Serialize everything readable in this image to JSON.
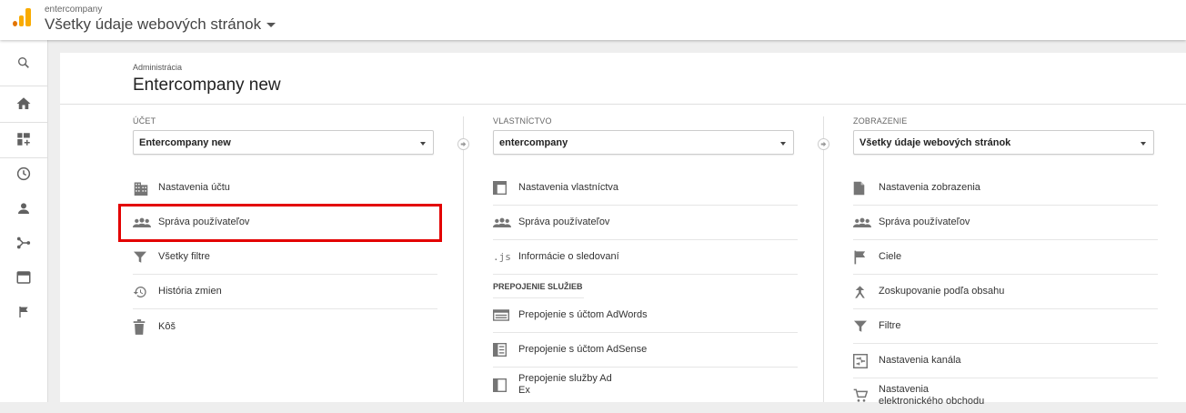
{
  "topbar": {
    "account_name": "entercompany",
    "view_name": "Všetky údaje webových stránok"
  },
  "colors": {
    "logo_orange": "#f9ab00",
    "logo_dark_orange": "#e37400",
    "highlight": "#e30000",
    "icon_gray": "#616161"
  },
  "rail": {
    "items": [
      {
        "icon": "search-icon"
      },
      {
        "icon": "home-icon"
      },
      {
        "icon": "customization-icon"
      },
      {
        "icon": "realtime-clock-icon"
      },
      {
        "icon": "audience-person-icon"
      },
      {
        "icon": "acquisition-icon"
      },
      {
        "icon": "behavior-icon"
      },
      {
        "icon": "conversions-flag-icon"
      }
    ]
  },
  "header": {
    "breadcrumb": "Administrácia",
    "title": "Entercompany new"
  },
  "account_col": {
    "label": "ÚČET",
    "selected": "Entercompany new",
    "items": [
      {
        "label": "Nastavenia účtu",
        "icon": "building-icon"
      },
      {
        "label": "Správa používateľov",
        "icon": "users-icon"
      },
      {
        "label": "Všetky filtre",
        "icon": "filter-icon"
      },
      {
        "label": "História zmien",
        "icon": "history-icon"
      },
      {
        "label": "Kôš",
        "icon": "trash-icon"
      }
    ]
  },
  "property_col": {
    "label": "VLASTNÍCTVO",
    "selected": "entercompany",
    "items": [
      {
        "label": "Nastavenia vlastníctva",
        "icon": "property-settings-icon"
      },
      {
        "label": "Správa používateľov",
        "icon": "users-icon"
      },
      {
        "label": "Informácie o sledovaní",
        "icon": "js-icon",
        "glyph": ".js"
      }
    ],
    "section_title": "PREPOJENIE SLUŽIEB",
    "section_items": [
      {
        "label": "Prepojenie s účtom AdWords",
        "icon": "adwords-icon"
      },
      {
        "label": "Prepojenie s účtom AdSense",
        "icon": "adsense-icon"
      },
      {
        "label": "Prepojenie služby Ad Ex",
        "icon": "adexchange-icon"
      }
    ]
  },
  "view_col": {
    "label": "ZOBRAZENIE",
    "selected": "Všetky údaje webových stránok",
    "items": [
      {
        "label": "Nastavenia zobrazenia",
        "icon": "document-icon"
      },
      {
        "label": "Správa používateľov",
        "icon": "users-icon"
      },
      {
        "label": "Ciele",
        "icon": "goal-flag-icon"
      },
      {
        "label": "Zoskupovanie podľa obsahu",
        "icon": "content-grouping-icon"
      },
      {
        "label": "Filtre",
        "icon": "filter-icon"
      },
      {
        "label": "Nastavenia kanála",
        "icon": "channel-settings-icon"
      },
      {
        "label": "Nastavenia elektronického obchodu",
        "icon": "cart-icon"
      }
    ]
  }
}
